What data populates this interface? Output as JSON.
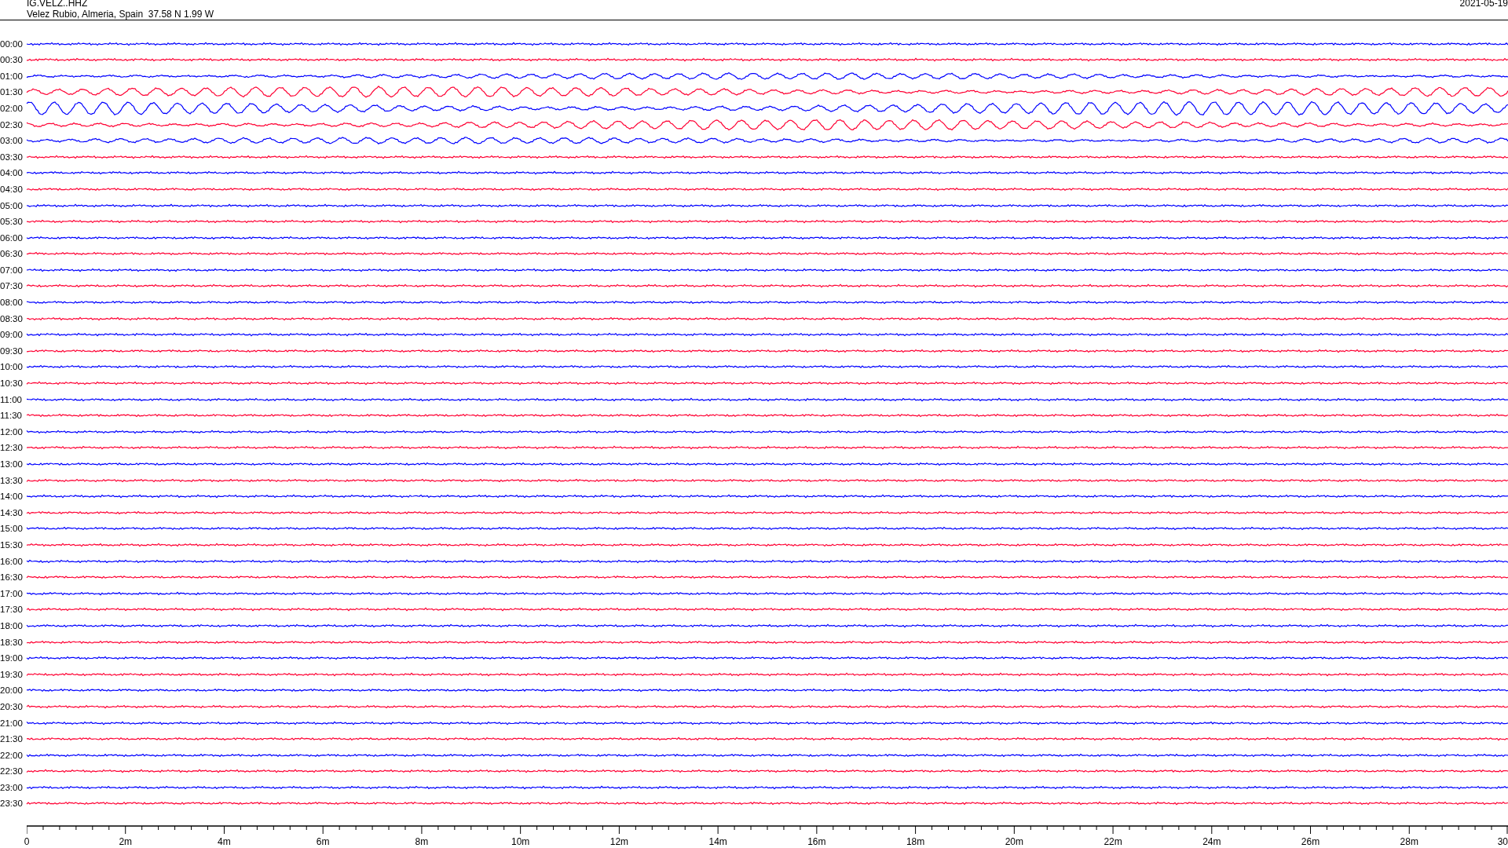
{
  "header": {
    "station": "IG.VELZ..HHZ",
    "location": "Velez Rubio, Almeria, Spain  37.58 N 1.99 W",
    "date": "2021-05-19"
  },
  "rows": [
    {
      "time": "00:00",
      "color": "#0000ff"
    },
    {
      "time": "00:30",
      "color": "#ff0033"
    },
    {
      "time": "01:00",
      "color": "#0000ff"
    },
    {
      "time": "01:30",
      "color": "#ff0033"
    },
    {
      "time": "02:00",
      "color": "#0000ff"
    },
    {
      "time": "02:30",
      "color": "#ff0033"
    },
    {
      "time": "03:00",
      "color": "#0000ff"
    },
    {
      "time": "03:30",
      "color": "#ff0033"
    },
    {
      "time": "04:00",
      "color": "#0000ff"
    },
    {
      "time": "04:30",
      "color": "#ff0033"
    },
    {
      "time": "05:00",
      "color": "#0000ff"
    },
    {
      "time": "05:30",
      "color": "#ff0033"
    },
    {
      "time": "06:00",
      "color": "#0000ff"
    },
    {
      "time": "06:30",
      "color": "#ff0033"
    },
    {
      "time": "07:00",
      "color": "#0000ff"
    },
    {
      "time": "07:30",
      "color": "#ff0033"
    },
    {
      "time": "08:00",
      "color": "#0000ff"
    },
    {
      "time": "08:30",
      "color": "#ff0033"
    },
    {
      "time": "09:00",
      "color": "#0000ff"
    },
    {
      "time": "09:30",
      "color": "#ff0033"
    },
    {
      "time": "10:00",
      "color": "#0000ff"
    },
    {
      "time": "10:30",
      "color": "#ff0033"
    },
    {
      "time": "11:00",
      "color": "#0000ff"
    },
    {
      "time": "11:30",
      "color": "#ff0033"
    },
    {
      "time": "12:00",
      "color": "#0000ff"
    },
    {
      "time": "12:30",
      "color": "#ff0033"
    },
    {
      "time": "13:00",
      "color": "#0000ff"
    },
    {
      "time": "13:30",
      "color": "#ff0033"
    },
    {
      "time": "14:00",
      "color": "#0000ff"
    },
    {
      "time": "14:30",
      "color": "#ff0033"
    },
    {
      "time": "15:00",
      "color": "#0000ff"
    },
    {
      "time": "15:30",
      "color": "#ff0033"
    },
    {
      "time": "16:00",
      "color": "#0000ff"
    },
    {
      "time": "16:30",
      "color": "#ff0033"
    },
    {
      "time": "17:00",
      "color": "#0000ff"
    },
    {
      "time": "17:30",
      "color": "#ff0033"
    },
    {
      "time": "18:00",
      "color": "#0000ff"
    },
    {
      "time": "18:30",
      "color": "#ff0033"
    },
    {
      "time": "19:00",
      "color": "#0000ff"
    },
    {
      "time": "19:30",
      "color": "#ff0033"
    },
    {
      "time": "20:00",
      "color": "#0000ff"
    },
    {
      "time": "20:30",
      "color": "#ff0033"
    },
    {
      "time": "21:00",
      "color": "#0000ff"
    },
    {
      "time": "21:30",
      "color": "#ff0033"
    },
    {
      "time": "22:00",
      "color": "#0000ff"
    },
    {
      "time": "22:30",
      "color": "#ff0033"
    },
    {
      "time": "23:00",
      "color": "#0000ff"
    },
    {
      "time": "23:30",
      "color": "#ff0033"
    }
  ],
  "axis": {
    "labels": [
      "0",
      "2m",
      "4m",
      "6m",
      "8m",
      "10m",
      "12m",
      "14m",
      "16m",
      "18m",
      "20m",
      "22m",
      "24m",
      "26m",
      "28m",
      "30"
    ]
  }
}
